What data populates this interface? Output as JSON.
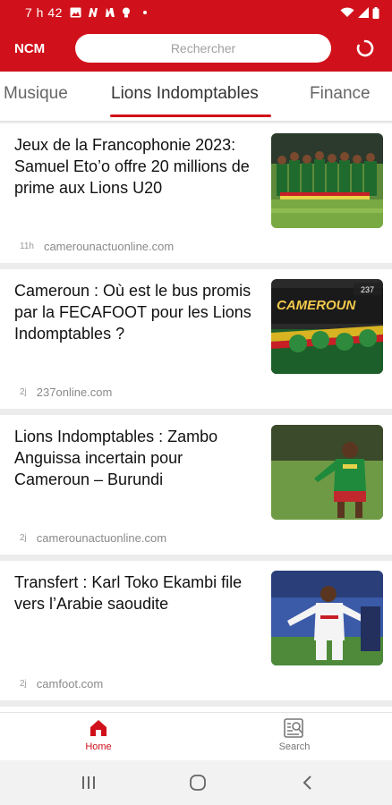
{
  "status_bar": {
    "time": "7 h 42",
    "icons": [
      "image-icon",
      "n-logo-icon",
      "n-alt-icon",
      "bulb-icon",
      "dot-icon"
    ],
    "right_icons": [
      "wifi-icon",
      "signal-icon",
      "battery-icon"
    ]
  },
  "app_bar": {
    "brand": "NCM",
    "search_placeholder": "Rechercher",
    "refresh_icon": "refresh-icon"
  },
  "tabs": [
    {
      "label": "Musique",
      "active": false
    },
    {
      "label": "Lions Indomptables",
      "active": true
    },
    {
      "label": "Finance",
      "active": false
    }
  ],
  "articles": [
    {
      "headline": "Jeux de la Francophonie 2023: Samuel Eto’o offre 20 millions de prime aux Lions U20",
      "age": "11h",
      "source": "camerounactuonline.com",
      "thumb": "team-photo"
    },
    {
      "headline": "Cameroun : Où est le bus promis par la FECAFOOT pour les Lions Indomptables ?",
      "age": "2j",
      "source": "237online.com",
      "thumb": "bus-cameroun",
      "thumb_overlay_text": "CAMEROUN",
      "thumb_tag": "237"
    },
    {
      "headline": "Lions Indomptables : Zambo Anguissa incertain pour Cameroun – Burundi",
      "age": "2j",
      "source": "camerounactuonline.com",
      "thumb": "player-green"
    },
    {
      "headline": "Transfert : Karl Toko Ekambi file vers l’Arabie saoudite",
      "age": "2j",
      "source": "camfoot.com",
      "thumb": "player-white"
    }
  ],
  "bottom_nav": [
    {
      "label": "Home",
      "icon": "home-icon",
      "active": true
    },
    {
      "label": "Search",
      "icon": "search-news-icon",
      "active": false
    }
  ],
  "system_nav": [
    "recents-icon",
    "home-circle-icon",
    "back-icon"
  ],
  "colors": {
    "brand_red": "#d0111b",
    "text": "#111111",
    "muted": "#8a8a8a"
  }
}
